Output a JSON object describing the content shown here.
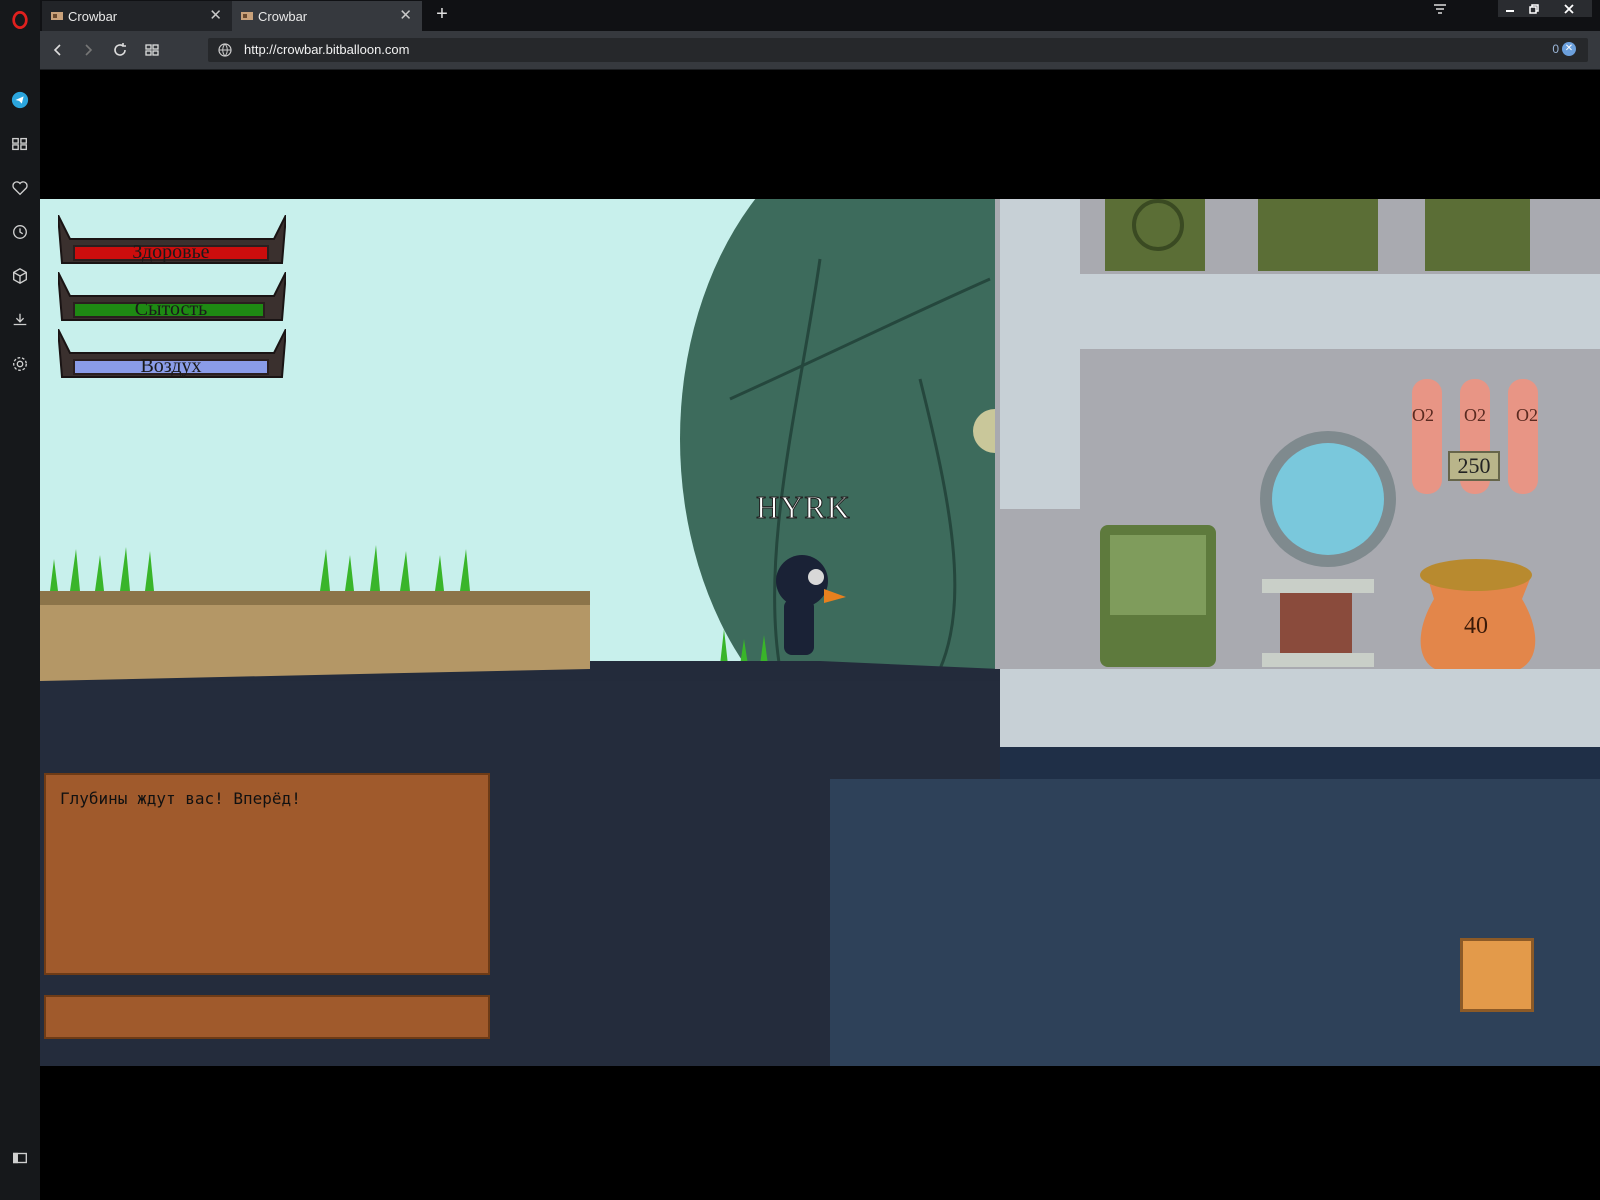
{
  "browser": {
    "tabs": [
      {
        "title": "Crowbar",
        "active": false
      },
      {
        "title": "Crowbar",
        "active": true
      }
    ],
    "new_tab_label": "+",
    "address": "http://crowbar.bitballoon.com",
    "adblock_count": "0",
    "window_controls": [
      "minimize",
      "restore",
      "close"
    ],
    "sidebar_icons": [
      "opera-logo-icon",
      "telegram-icon",
      "speed-dial-icon",
      "heart-icon",
      "history-icon",
      "cube-icon",
      "download-icon",
      "settings-icon",
      "sidebar-toggle-icon"
    ]
  },
  "game": {
    "hud": {
      "health": {
        "label": "Здоровье",
        "value": 1.0,
        "color": "#cc0d0d"
      },
      "satiety": {
        "label": "Сытость",
        "value": 0.98,
        "color": "#1e8a13"
      },
      "air": {
        "label": "Воздух",
        "value": 1.0,
        "color": "#8a9ce8"
      }
    },
    "player_name": "HYRK",
    "message": "Глубины ждут вас! Вперёд!",
    "oxygen_tank_label": "O2",
    "oxygen_amount": "250",
    "sack_amount": "40",
    "colors": {
      "sky": "#c8f0ec",
      "ground": "#232b3b",
      "water": "#2e4159",
      "panel": "#a05a2c",
      "hull": "#3d6b5c"
    }
  }
}
